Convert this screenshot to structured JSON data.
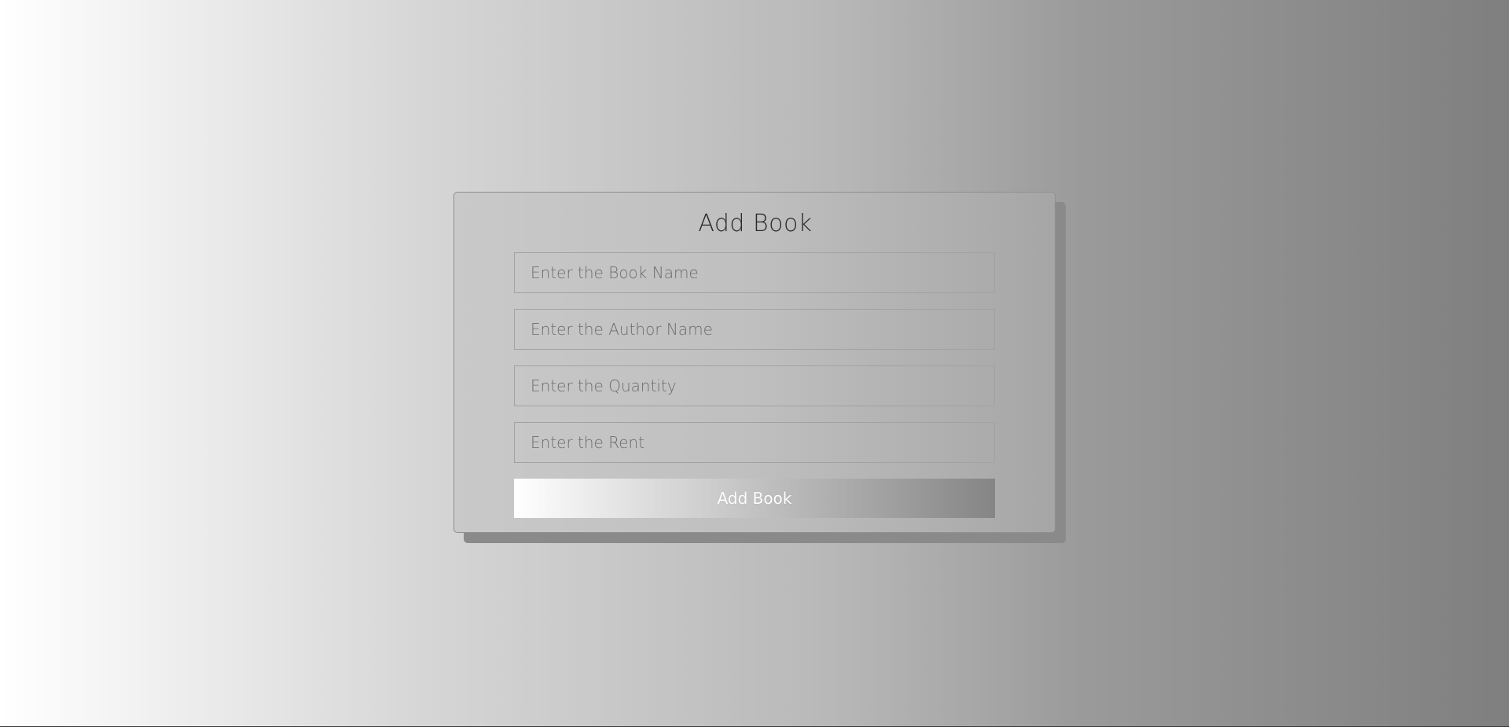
{
  "form": {
    "title": "Add Book",
    "fields": [
      {
        "placeholder": "Enter the Book Name",
        "value": ""
      },
      {
        "placeholder": "Enter the Author Name",
        "value": ""
      },
      {
        "placeholder": "Enter the Quantity",
        "value": ""
      },
      {
        "placeholder": "Enter the Rent",
        "value": ""
      }
    ],
    "submit_label": "Add Book"
  }
}
